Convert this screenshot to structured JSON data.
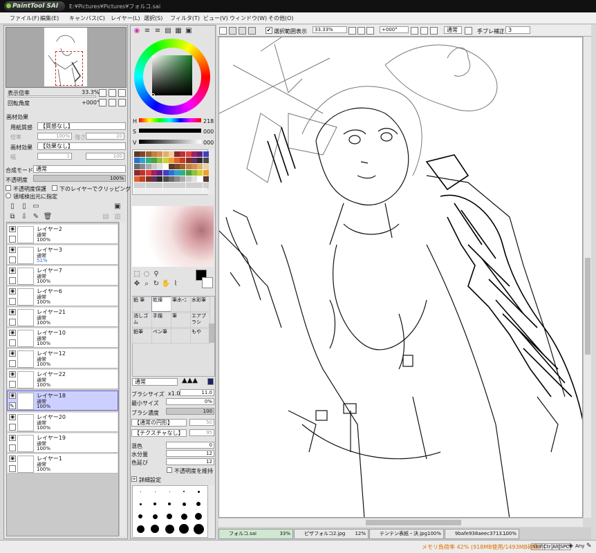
{
  "app": {
    "logo": "PaintTool SAI",
    "path": "E:¥Pictures¥Pictures¥フォルコ.sai"
  },
  "menu": [
    "ファイル(F)",
    "編集(E)",
    "キャンバス(C)",
    "レイヤー(L)",
    "選択(S)",
    "フィルタ(T)",
    "ビュー(V)",
    "ウィンドウ(W)",
    "その他(O)"
  ],
  "navigator": {
    "zoom_label": "表示倍率",
    "zoom_value": "33.3%",
    "angle_label": "回転角度",
    "angle_value": "+000°"
  },
  "paper": {
    "section": "画材効果",
    "texture_label": "用紙質感",
    "texture_value": "【質感なし】",
    "scale_label": "倍率",
    "scale_value": "100%",
    "strength_label": "強さ",
    "strength_value": "20",
    "effect_label": "画材効果",
    "effect_value": "【効果なし】",
    "width_label": "幅",
    "width_value": "1",
    "strength2_value": "100"
  },
  "layer_opts": {
    "blend_label": "合成モード",
    "blend_value": "通常",
    "opacity_label": "不透明度",
    "opacity_value": "100%",
    "preserve_opacity": "不透明度保護",
    "clipping": "下のレイヤーでクリッピング",
    "selection_source": "領域検出元に指定"
  },
  "layers": [
    {
      "name": "レイヤー2",
      "mode": "通常",
      "opacity": "100%"
    },
    {
      "name": "レイヤー3",
      "mode": "通常",
      "opacity": "51%"
    },
    {
      "name": "レイヤー7",
      "mode": "通常",
      "opacity": "100%"
    },
    {
      "name": "レイヤー6",
      "mode": "通常",
      "opacity": "100%"
    },
    {
      "name": "レイヤー21",
      "mode": "通常",
      "opacity": "100%"
    },
    {
      "name": "レイヤー10",
      "mode": "通常",
      "opacity": "100%"
    },
    {
      "name": "レイヤー12",
      "mode": "通常",
      "opacity": "100%"
    },
    {
      "name": "レイヤー22",
      "mode": "通常",
      "opacity": "100%"
    },
    {
      "name": "レイヤー18",
      "mode": "通常",
      "opacity": "100%"
    },
    {
      "name": "レイヤー20",
      "mode": "通常",
      "opacity": "100%"
    },
    {
      "name": "レイヤー19",
      "mode": "通常",
      "opacity": "100%"
    },
    {
      "name": "レイヤー1",
      "mode": "通常",
      "opacity": "100%"
    }
  ],
  "color": {
    "h_label": "H",
    "h_value": "218",
    "s_label": "S",
    "s_value": "000",
    "v_label": "V",
    "v_value": "000",
    "primary": "#000000"
  },
  "brushes": [
    [
      "鉛 筆",
      "乾燥",
      "筆水ｰﾆ",
      "水彩筆"
    ],
    [
      "消しゴム",
      "手描",
      "筆",
      "エアブラシ"
    ],
    [
      "鉛筆",
      "ペン筆",
      "",
      "もや"
    ]
  ],
  "brush_opts": {
    "mode": "通常",
    "size_label": "ブラシサイズ",
    "size_mult": "x1.0",
    "size_value": "11.0",
    "min_label": "最小サイズ",
    "min_value": "0%",
    "density_label": "ブラシ濃度",
    "density_value": "100",
    "shape": "【通常の円形】",
    "shape_val": "50",
    "texture": "【テクスチャなし】",
    "texture_val": "95",
    "blend_label": "混色",
    "blend_value": "0",
    "water_label": "水分量",
    "water_value": "12",
    "extend_label": "色延び",
    "extend_value": "12",
    "keep_opacity": "不透明度を維持",
    "detail": "詳細設定"
  },
  "size_grid": [
    [
      "·",
      "·",
      "·",
      "1",
      "1.5",
      "2"
    ],
    [
      "2.3",
      "2.6",
      "3",
      "3.5",
      "4"
    ],
    [
      "5",
      "6",
      "7",
      "8",
      "9"
    ],
    [
      "10",
      "12",
      "14",
      "16",
      "20"
    ]
  ],
  "toolbar": {
    "show_selection": "選択範囲表示",
    "zoom": "33.33%",
    "angle": "+000°",
    "mode": "通常",
    "stabilizer_label": "手ブレ補正",
    "stabilizer_value": "3"
  },
  "tabs": [
    {
      "name": "フォルコ.sai",
      "pct": "33%"
    },
    {
      "name": "ピザフォルコ2.jpg",
      "pct": "12%"
    },
    {
      "name": "テンテン表紙・決.jpg",
      "pct": "100%"
    },
    {
      "name": "9bafe938aeec3713...",
      "pct": "100%"
    }
  ],
  "status": {
    "memory": "メモリ負荷率 42% (918MB使用/1493MB確保)",
    "keys": [
      "Shift",
      "Ctrl",
      "Alt",
      "SPC"
    ],
    "any": "Any"
  },
  "colors": {
    "accent_sel": "#cdd0ff",
    "memory_text": "#e07000"
  }
}
